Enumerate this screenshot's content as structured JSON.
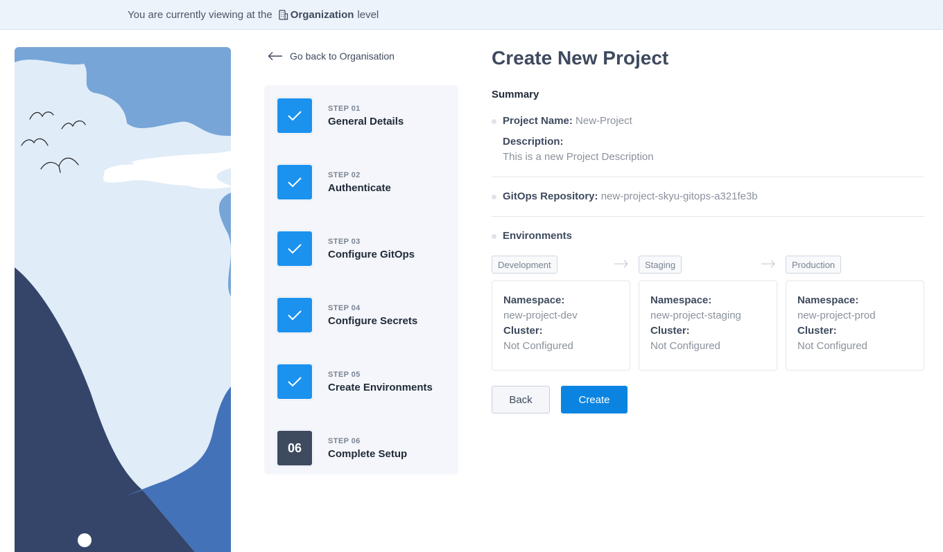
{
  "banner": {
    "prefix": "You are currently viewing at the",
    "org": "Organization",
    "suffix": "level"
  },
  "nav": {
    "back_label": "Go back to Organisation"
  },
  "steps": [
    {
      "num": "STEP 01",
      "title": "General Details",
      "status": "done"
    },
    {
      "num": "STEP 02",
      "title": "Authenticate",
      "status": "done"
    },
    {
      "num": "STEP 03",
      "title": "Configure GitOps",
      "status": "done"
    },
    {
      "num": "STEP 04",
      "title": "Configure Secrets",
      "status": "done"
    },
    {
      "num": "STEP 05",
      "title": "Create Environments",
      "status": "done"
    },
    {
      "num": "STEP 06",
      "title": "Complete Setup",
      "status": "current",
      "badge": "06"
    }
  ],
  "main": {
    "title": "Create New Project",
    "summary_label": "Summary",
    "project_name_key": "Project Name:",
    "project_name_value": "New-Project",
    "description_key": "Description:",
    "description_value": "This is a new Project Description",
    "gitops_key": "GitOps Repository:",
    "gitops_value": "new-project-skyu-gitops-a321fe3b",
    "environments_label": "Environments"
  },
  "environments": [
    {
      "name": "Development",
      "namespace_key": "Namespace:",
      "namespace": "new-project-dev",
      "cluster_key": "Cluster:",
      "cluster": "Not Configured"
    },
    {
      "name": "Staging",
      "namespace_key": "Namespace:",
      "namespace": "new-project-staging",
      "cluster_key": "Cluster:",
      "cluster": "Not Configured"
    },
    {
      "name": "Production",
      "namespace_key": "Namespace:",
      "namespace": "new-project-prod",
      "cluster_key": "Cluster:",
      "cluster": "Not Configured"
    }
  ],
  "actions": {
    "back_label": "Back",
    "create_label": "Create"
  },
  "colors": {
    "accent": "#0a84e0",
    "step_done": "#1c92ef",
    "step_current": "#3e4a5e",
    "banner_bg": "#ecf3fb"
  },
  "icons": {
    "banner": "building-icon",
    "back": "arrow-left-icon",
    "step_done": "check-icon",
    "env_separator": "arrow-right-icon"
  }
}
